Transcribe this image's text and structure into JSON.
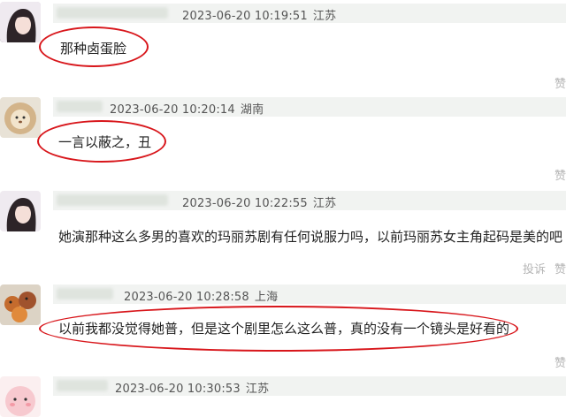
{
  "comments": [
    {
      "timestamp": "2023-06-20 10:19:51",
      "location": "江苏",
      "text": "那种卤蛋脸",
      "actions": [
        "赞"
      ]
    },
    {
      "timestamp": "2023-06-20 10:20:14",
      "location": "湖南",
      "text": "一言以蔽之，丑",
      "actions": [
        "赞"
      ]
    },
    {
      "timestamp": "2023-06-20 10:22:55",
      "location": "江苏",
      "text": "她演那种这么多男的喜欢的玛丽苏剧有任何说服力吗，以前玛丽苏女主角起码是美的吧",
      "actions": [
        "投诉",
        "赞"
      ]
    },
    {
      "timestamp": "2023-06-20 10:28:58",
      "location": "上海",
      "text": "以前我都没觉得她普，但是这个剧里怎么这么普，真的没有一个镜头是好看的",
      "actions": [
        "赞"
      ]
    },
    {
      "timestamp": "2023-06-20 10:30:53",
      "location": "江苏",
      "text": "",
      "actions": []
    }
  ],
  "colors": {
    "highlight_ellipse": "#d8161b",
    "header_bar": "#f1f3f1"
  }
}
